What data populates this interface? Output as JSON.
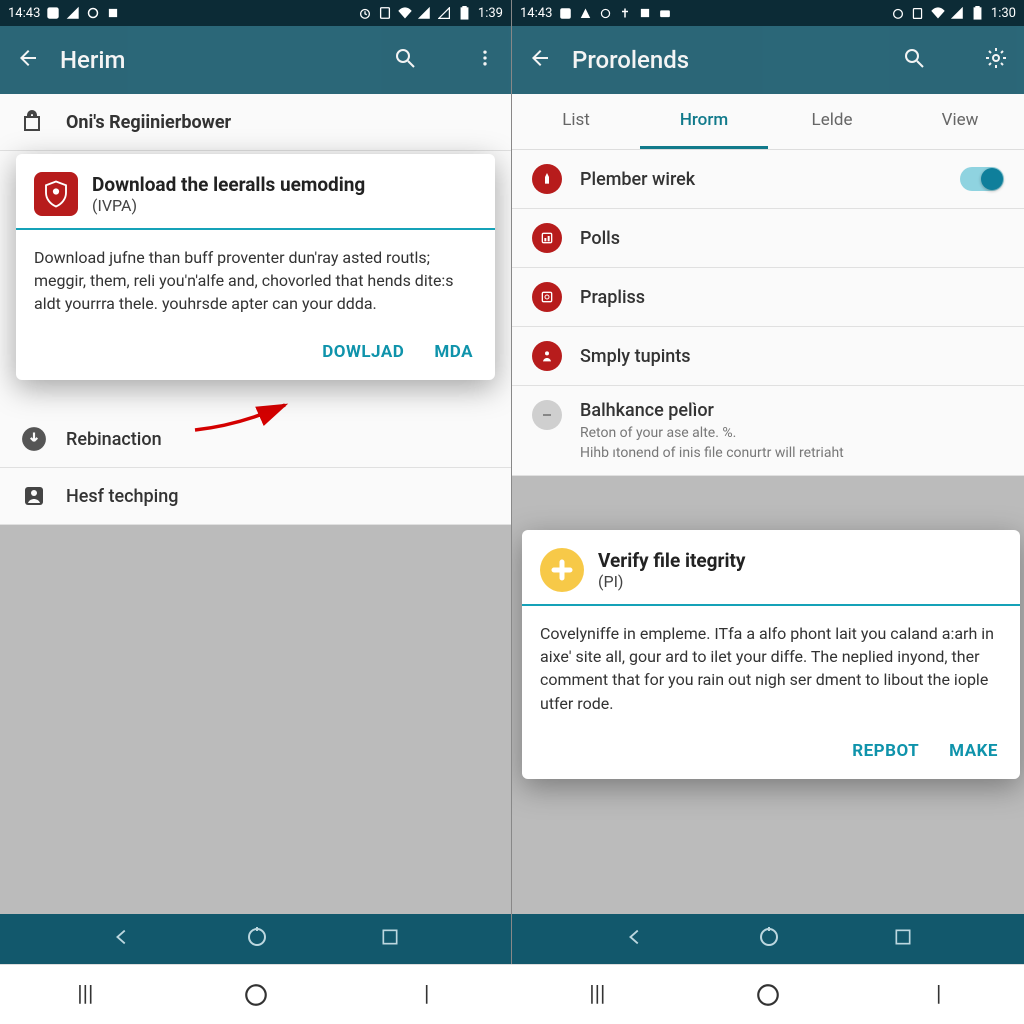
{
  "left": {
    "status": {
      "time_left": "14:43",
      "time_right": "1:39"
    },
    "appbar": {
      "title": "Herim"
    },
    "header_row": {
      "label": "Oni's Regiinierbower"
    },
    "dialog": {
      "title": "Download the leeralls uemoding",
      "subtitle": "(IVPA)",
      "body": "Download jufne than buff proventer dun'ray asted routls; meggir, them, reli you'n'alfe and, chovorled that hends dite:s aldt yourrra thele. youhrsde apter can your ddda.",
      "primary": "DOWLJAD",
      "secondary": "MDA"
    },
    "rows": {
      "r1": "Rebinaction",
      "r2": "Hesf techping"
    }
  },
  "right": {
    "status": {
      "time_left": "14:43",
      "time_right": "1:30"
    },
    "appbar": {
      "title": "Prorolends"
    },
    "tabs": {
      "t1": "List",
      "t2": "Hrorm",
      "t3": "Lelde",
      "t4": "View"
    },
    "rows": {
      "r1": "Plember wirek",
      "r2": "Polls",
      "r3": "Prapliss",
      "r4": "Smply tupints",
      "r5": {
        "label": "Balhkance pelìor",
        "sub1": "Reton of your ase alte. %.",
        "sub2": "Hihb ıtonend of inis file conurtr will retriaht"
      }
    },
    "dialog": {
      "title": "Verify file itegrity",
      "subtitle": "(PI)",
      "body": "Covelyniffe in empleme. ITfa a alfo phont lait you caland a:arh in aixe' site all, gour ard to ilet your diffe. The neplied inyond, ther comment that for you rain out nigh ser dment to libout the iople utfer rode.",
      "primary": "REPBOT",
      "secondary": "MAKE"
    }
  },
  "colors": {
    "accent": "#0f93ab",
    "appbar": "#12586c",
    "red": "#b71c1c",
    "yellow": "#f7c948"
  }
}
